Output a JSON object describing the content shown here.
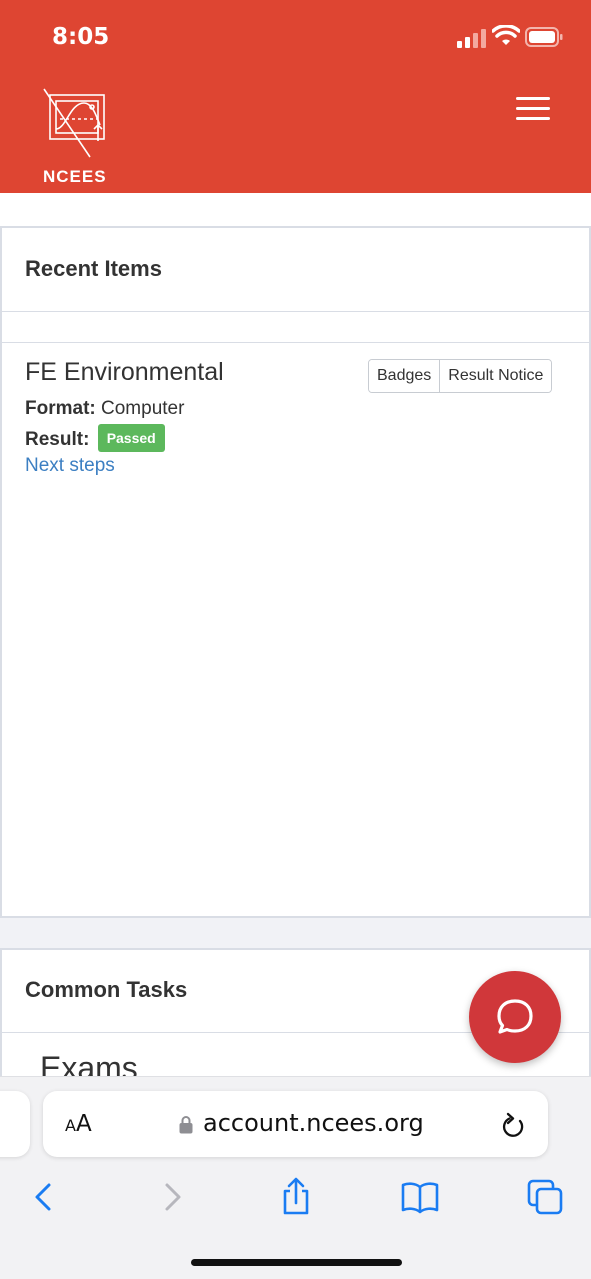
{
  "status": {
    "time": "8:05"
  },
  "header": {
    "logo_text": "NCEES"
  },
  "recent": {
    "title": "Recent Items",
    "item": {
      "name": "FE Environmental",
      "buttons": [
        "Badges",
        "Result Notice"
      ],
      "format_label": "Format:",
      "format_value": "Computer",
      "result_label": "Result:",
      "result_value": "Passed",
      "next_steps": "Next steps"
    }
  },
  "common": {
    "title": "Common Tasks",
    "exams": "Exams"
  },
  "browser": {
    "aa_small": "A",
    "aa_large": "A",
    "url": "account.ncees.org"
  },
  "colors": {
    "brand": "#de4532",
    "passed": "#5cb85c",
    "link": "#3c7fc2",
    "fab": "#d0373a",
    "ios_blue": "#1a7cf2"
  },
  "icons": [
    "cellular-signal-icon",
    "wifi-icon",
    "battery-icon",
    "hamburger-menu-icon",
    "chat-icon",
    "lock-icon",
    "reload-icon",
    "back-icon",
    "forward-icon",
    "share-icon",
    "bookmarks-icon",
    "tabs-icon"
  ]
}
